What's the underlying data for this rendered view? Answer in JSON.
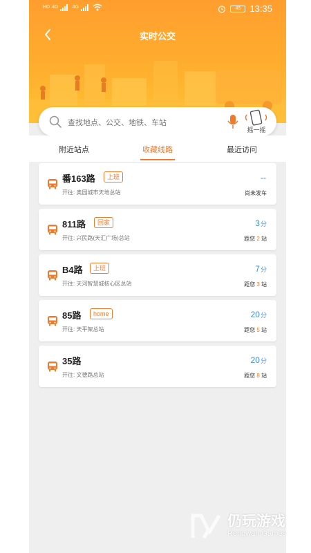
{
  "status_bar": {
    "left_indicators": [
      "HD",
      "4G",
      "4G"
    ],
    "battery_level": "45",
    "time": "13:35"
  },
  "header": {
    "title": "实时公交",
    "back_icon": "chevron-left-icon"
  },
  "search": {
    "placeholder": "查找地点、公交、地铁、车站",
    "shake_label": "摇一摇"
  },
  "tabs": [
    {
      "label": "附近站点",
      "active": false
    },
    {
      "label": "收藏线路",
      "active": true
    },
    {
      "label": "最近访问",
      "active": false
    }
  ],
  "routes": [
    {
      "name": "番163路",
      "tag": "上班",
      "direction": "开往: 奥园城市天地总站",
      "eta": "--",
      "eta_unit": "",
      "status": "尚未发车",
      "stops_prefix": "",
      "stops_num": "",
      "stops_suffix": ""
    },
    {
      "name": "811路",
      "tag": "回家",
      "direction": "开往: 兴民路(天汇广场)总站",
      "eta": "3",
      "eta_unit": "分",
      "status": "",
      "stops_prefix": "距您 ",
      "stops_num": "2",
      "stops_suffix": " 站"
    },
    {
      "name": "B4路",
      "tag": "上班",
      "direction": "开往: 天河智慧城核心区总站",
      "eta": "7",
      "eta_unit": "分",
      "status": "",
      "stops_prefix": "距您 ",
      "stops_num": "3",
      "stops_suffix": " 站"
    },
    {
      "name": "85路",
      "tag": "home",
      "direction": "开往: 天平架总站",
      "eta": "20",
      "eta_unit": "分",
      "status": "",
      "stops_prefix": "距您 ",
      "stops_num": "5",
      "stops_suffix": " 站"
    },
    {
      "name": "35路",
      "tag": "",
      "direction": "开往: 文德路总站",
      "eta": "20",
      "eta_unit": "分",
      "status": "",
      "stops_prefix": "距您 ",
      "stops_num": "8",
      "stops_suffix": " 站"
    }
  ],
  "watermark": {
    "text": "仍玩游戏",
    "sub": "Rengwan Games"
  },
  "colors": {
    "accent": "#ef7a2a",
    "eta_blue": "#3a8fd9",
    "hero_top": "#ff9e2e",
    "hero_bottom": "#ffc232"
  }
}
